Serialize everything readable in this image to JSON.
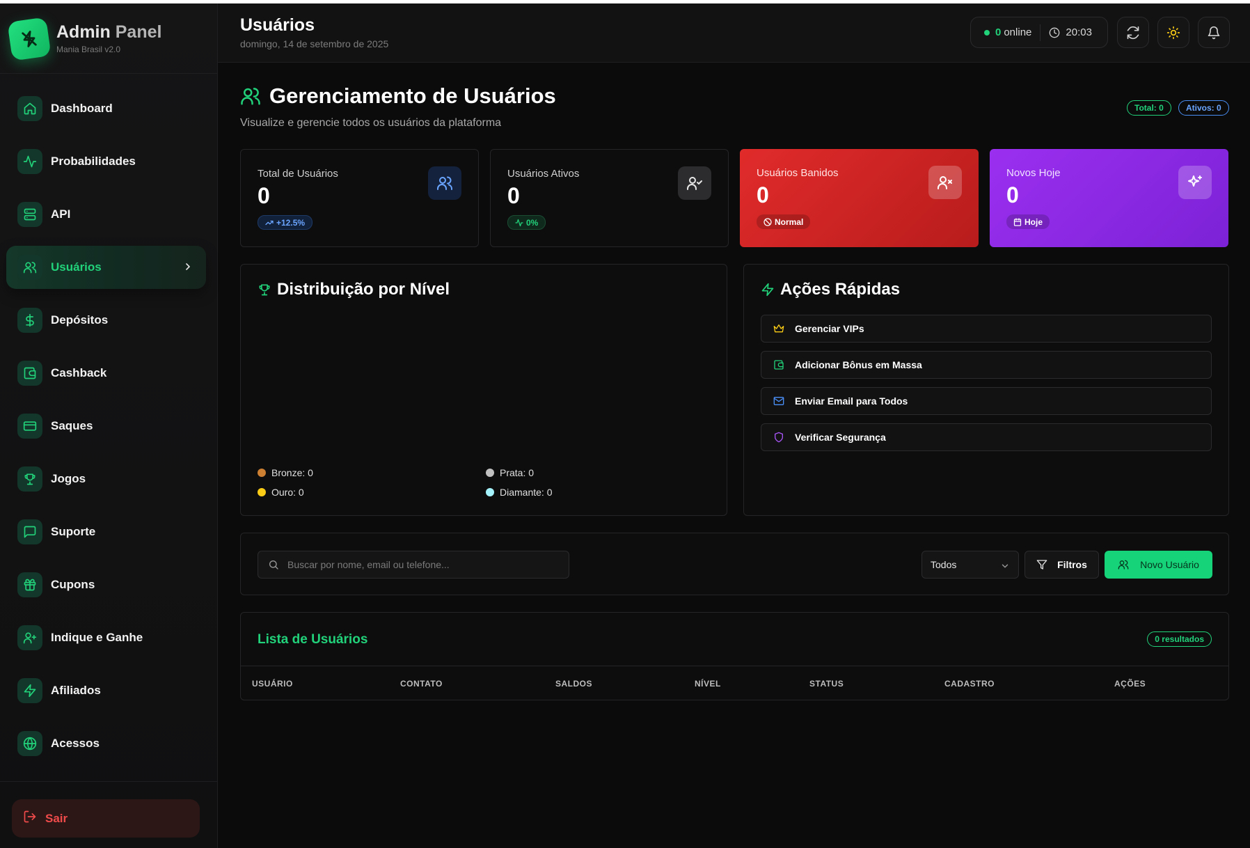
{
  "brand": {
    "title_main": "Admin",
    "title_accent": "Panel",
    "subtitle": "Mania Brasil v2.0"
  },
  "sidebar": {
    "items": [
      {
        "label": "Dashboard",
        "icon": "home-icon"
      },
      {
        "label": "Probabilidades",
        "icon": "activity-icon"
      },
      {
        "label": "API",
        "icon": "server-icon"
      },
      {
        "label": "Usuários",
        "icon": "users-icon",
        "active": true
      },
      {
        "label": "Depósitos",
        "icon": "dollar-icon"
      },
      {
        "label": "Cashback",
        "icon": "wallet-icon"
      },
      {
        "label": "Saques",
        "icon": "credit-card-icon"
      },
      {
        "label": "Jogos",
        "icon": "trophy-icon"
      },
      {
        "label": "Suporte",
        "icon": "message-icon"
      },
      {
        "label": "Cupons",
        "icon": "gift-icon"
      },
      {
        "label": "Indique e Ganhe",
        "icon": "user-plus-icon"
      },
      {
        "label": "Afiliados",
        "icon": "zap-icon"
      },
      {
        "label": "Acessos",
        "icon": "globe-icon"
      }
    ],
    "logout_label": "Sair"
  },
  "header": {
    "title": "Usuários",
    "date": "domingo, 14 de setembro de 2025",
    "online_count": "0",
    "online_label": "online",
    "time": "20:03"
  },
  "page": {
    "title": "Gerenciamento de Usuários",
    "subtitle": "Visualize e gerencie todos os usuários da plataforma",
    "total_badge": "Total: 0",
    "active_badge": "Ativos: 0"
  },
  "stats": [
    {
      "label": "Total de Usuários",
      "value": "0",
      "chip": "+12.5%"
    },
    {
      "label": "Usuários Ativos",
      "value": "0",
      "chip": "0%"
    },
    {
      "label": "Usuários Banidos",
      "value": "0",
      "chip": "Normal"
    },
    {
      "label": "Novos Hoje",
      "value": "0",
      "chip": "Hoje"
    }
  ],
  "distribution": {
    "title": "Distribuição por Nível",
    "legend": [
      {
        "label": "Bronze: 0",
        "color": "#cd7f32"
      },
      {
        "label": "Prata: 0",
        "color": "#c0c0c0"
      },
      {
        "label": "Ouro: 0",
        "color": "#facc15"
      },
      {
        "label": "Diamante: 0",
        "color": "#a5f3fc"
      }
    ]
  },
  "quick_actions": {
    "title": "Ações Rápidas",
    "items": [
      {
        "label": "Gerenciar VIPs",
        "icon": "crown-icon",
        "color": "#facc15"
      },
      {
        "label": "Adicionar Bônus em Massa",
        "icon": "wallet-icon",
        "color": "#22d27a"
      },
      {
        "label": "Enviar Email para Todos",
        "icon": "mail-icon",
        "color": "#4a8ff5"
      },
      {
        "label": "Verificar Segurança",
        "icon": "shield-icon",
        "color": "#a855f7"
      }
    ]
  },
  "filters": {
    "search_placeholder": "Buscar por nome, email ou telefone...",
    "select_value": "Todos",
    "filter_label": "Filtros",
    "new_user_label": "Novo Usuário"
  },
  "table": {
    "title": "Lista de Usuários",
    "results": "0 resultados",
    "columns": [
      "USUÁRIO",
      "CONTATO",
      "SALDOS",
      "NÍVEL",
      "STATUS",
      "CADASTRO",
      "AÇÕES"
    ]
  },
  "colors": {
    "accent": "#22d27a",
    "danger": "#e12b2b",
    "purple": "#9b2ff0",
    "info": "#4a8ff5"
  }
}
